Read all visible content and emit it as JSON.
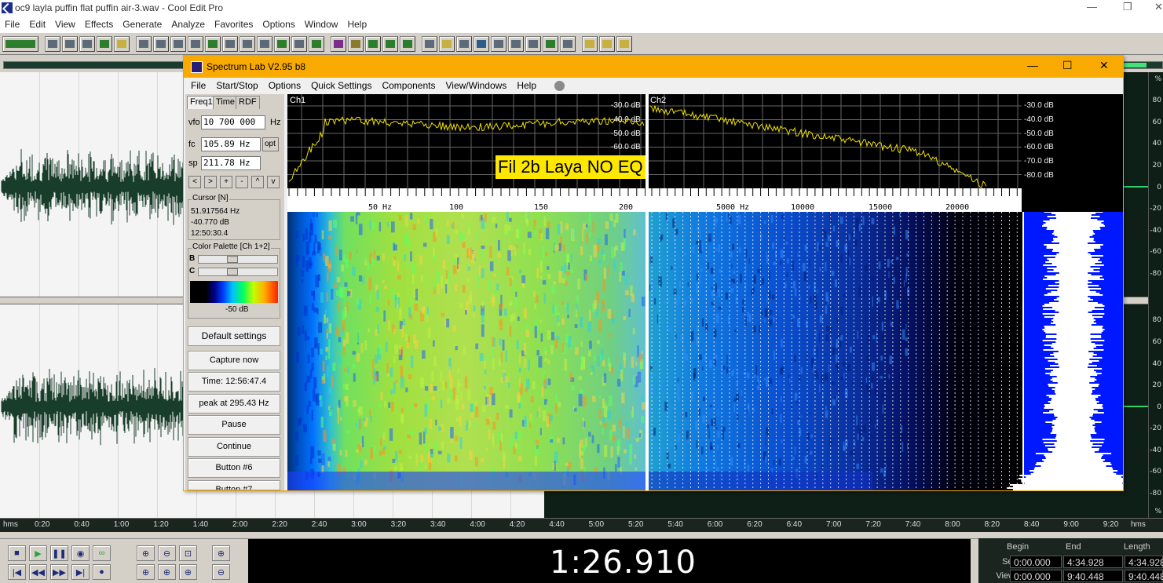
{
  "outer_window": {
    "title": "oc9 layla puffin flat puffin air-3.wav - Cool Edit Pro",
    "menu": [
      "File",
      "Edit",
      "View",
      "Effects",
      "Generate",
      "Analyze",
      "Favorites",
      "Options",
      "Window",
      "Help"
    ]
  },
  "wave_view": {
    "db_scale_top": [
      "%",
      "80",
      "60",
      "40",
      "20",
      "0",
      "-20",
      "-40",
      "-60",
      "-80"
    ],
    "db_scale_bottom": [
      "80",
      "60",
      "40",
      "20",
      "0",
      "-20",
      "-40",
      "-60",
      "-80",
      "%"
    ],
    "time_ruler": [
      "hms",
      "0:20",
      "0:40",
      "1:00",
      "1:20",
      "1:40",
      "2:00",
      "2:20",
      "2:40",
      "3:00",
      "3:20",
      "3:40",
      "4:00",
      "4:20",
      "4:40",
      "5:00",
      "5:20",
      "5:40",
      "6:00",
      "6:20",
      "6:40",
      "7:00",
      "7:20",
      "7:40",
      "8:00",
      "8:20",
      "8:40",
      "9:00",
      "9:20",
      "hms"
    ]
  },
  "transport": {
    "time_display": "1:26.910",
    "headers": {
      "begin": "Begin",
      "end": "End",
      "length": "Length"
    },
    "sel": {
      "label": "Sel",
      "begin": "0:00.000",
      "end": "4:34.928",
      "length": "4:34.928"
    },
    "view": {
      "label": "View",
      "begin": "0:00.000",
      "end": "9:40.448",
      "length": "9:40.448"
    }
  },
  "spectrum_lab": {
    "title": "Spectrum Lab V2.95 b8",
    "menu": [
      "File",
      "Start/Stop",
      "Options",
      "Quick Settings",
      "Components",
      "View/Windows",
      "Help"
    ],
    "tabs": [
      "Freq1",
      "Time",
      "RDF"
    ],
    "vfo_label": "vfo",
    "vfo_value": "10 700 000",
    "vfo_unit": "Hz",
    "fc_label": "fc",
    "fc_value": "105.89 Hz",
    "fc_button": "opt",
    "sp_label": "sp",
    "sp_value": "211.78 Hz",
    "nav_buttons": [
      "<",
      ">",
      "+",
      "-",
      "^",
      "v"
    ],
    "cursor": {
      "title": "Cursor [N]",
      "freq": "51.917564 Hz",
      "level": "-40.770 dB",
      "time": "12:50:30.4"
    },
    "palette": {
      "title": "Color Palette [Ch 1+2]",
      "b_label": "B",
      "c_label": "C",
      "level": "-50 dB"
    },
    "buttons": {
      "default_settings": "Default settings",
      "capture_now": "Capture now",
      "time": "Time:  12:56:47.4",
      "peak": "peak at 295.43 Hz",
      "pause": "Pause",
      "continue": "Continue",
      "button6": "Button #6",
      "button7": "Button #7"
    },
    "ch1_label": "Ch1",
    "ch2_label": "Ch2",
    "db_levels": [
      "-30.0 dB",
      "-40.0 dB",
      "-50.0 dB",
      "-60.0 dB",
      "-70.0 dB",
      "-80.0 dB"
    ],
    "ch1_freq_ticks": [
      "50 Hz",
      "100",
      "150",
      "200"
    ],
    "ch2_freq_ticks": [
      "5000 Hz",
      "10000",
      "15000",
      "20000"
    ],
    "overlay_text": "Fil 2b Laya NO EQ"
  }
}
